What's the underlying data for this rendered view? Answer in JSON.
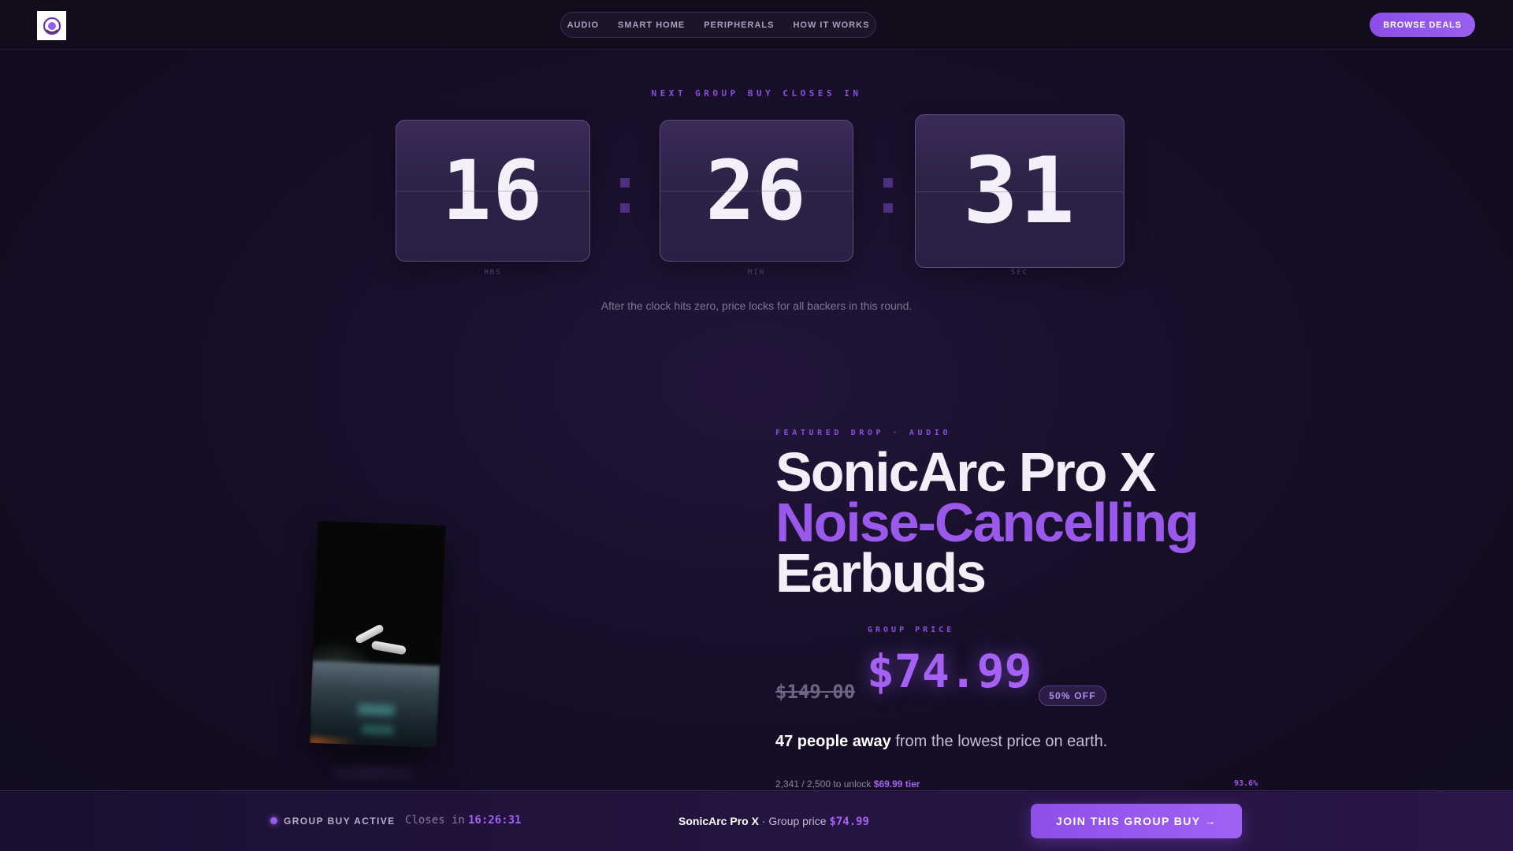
{
  "nav": {
    "logo_icon": "wreath-logo-icon",
    "links": [
      "AUDIO",
      "SMART HOME",
      "PERIPHERALS",
      "HOW IT WORKS"
    ],
    "cta_label": "BROWSE DEALS"
  },
  "countdown": {
    "eyebrow": "NEXT GROUP BUY CLOSES IN",
    "hours": "16",
    "minutes": "26",
    "seconds": "31",
    "hours_label": "HRS",
    "minutes_label": "MIN",
    "seconds_label": "SEC",
    "note": "After the clock hits zero, price locks for all backers in this round."
  },
  "product": {
    "eyebrow": "FEATURED DROP · AUDIO",
    "title_line1": "SonicArc Pro X",
    "title_line2": "Noise-Cancelling",
    "title_line3": "Earbuds",
    "group_price_label": "GROUP PRICE",
    "original_price": "$149.00",
    "group_price": "$74.99",
    "discount_badge": "50% OFF",
    "people_count": "47 people away",
    "people_suffix": " from the lowest price on earth.",
    "progress_text": "2,341 / 2,500 to unlock ",
    "progress_tier": "$69.99 tier",
    "progress_percent": "93.6%",
    "progress_fraction": 0.936
  },
  "sticky": {
    "status": "GROUP BUY ACTIVE",
    "closes_label": "Closes in",
    "closes_time": "16:26:31",
    "product_name": "SonicArc Pro X",
    "price_prefix": " · Group price ",
    "price": "$74.99",
    "cta_label": "JOIN THIS GROUP BUY →"
  },
  "colors": {
    "accent": "#9b59ec",
    "background": "#170f28"
  }
}
